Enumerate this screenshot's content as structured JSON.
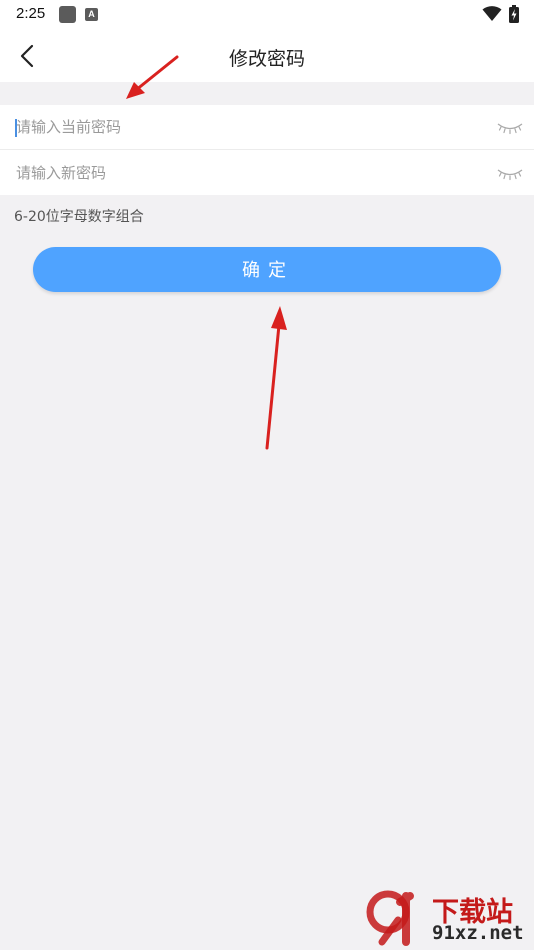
{
  "status_bar": {
    "time": "2:25",
    "keyboard_label": "A",
    "icons": [
      "app-icon",
      "keyboard-icon",
      "wifi-icon",
      "battery-icon"
    ]
  },
  "header": {
    "title": "修改密码",
    "back_icon": "chevron-left-icon"
  },
  "form": {
    "current_password": {
      "placeholder": "请输入当前密码",
      "value": "",
      "toggle_icon": "eye-closed-icon"
    },
    "new_password": {
      "placeholder": "请输入新密码",
      "value": "",
      "toggle_icon": "eye-closed-icon"
    },
    "hint": "6-20位字母数字组合"
  },
  "confirm_button": {
    "label": "确定"
  },
  "watermark": {
    "main": "下载站",
    "sub": "91xz.net"
  },
  "colors": {
    "background": "#f2f1f3",
    "button": "#4fa3ff",
    "arrow": "#d9211f",
    "caret": "#4a90e2",
    "watermark": "#c41a1a"
  }
}
